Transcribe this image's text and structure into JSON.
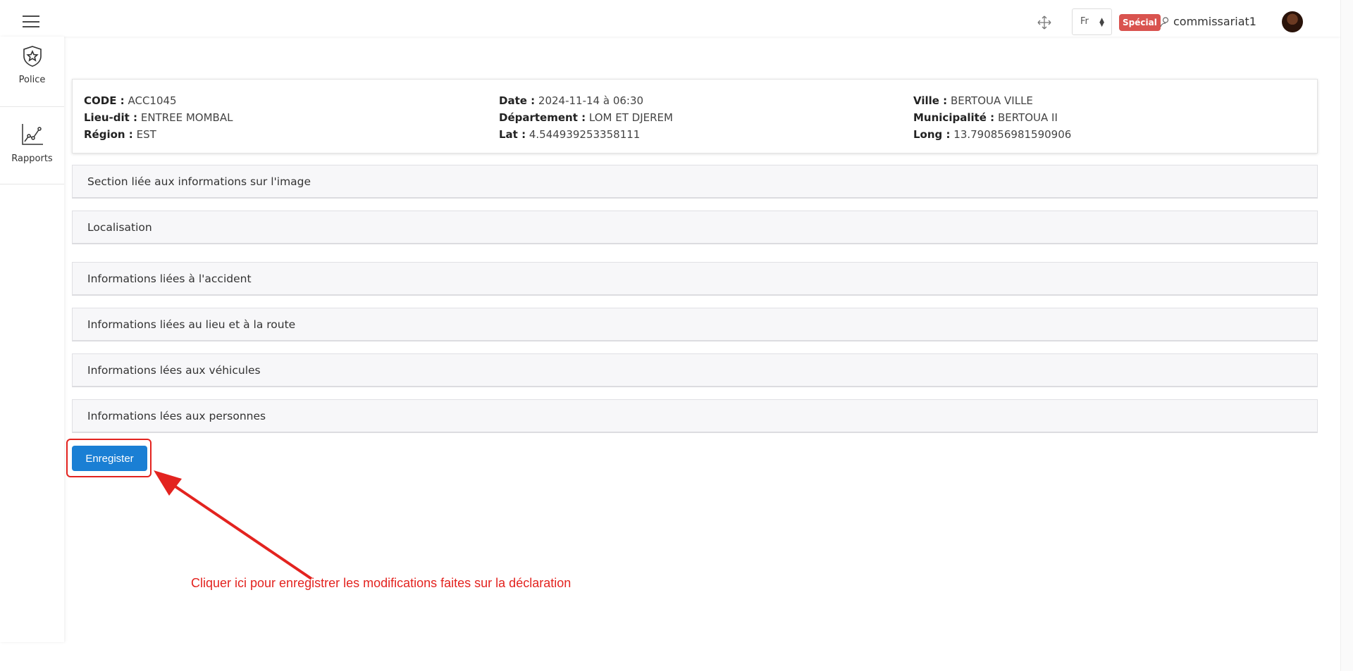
{
  "topbar": {
    "language": "Fr",
    "badge": "Spécial",
    "username": "commissariat1",
    "icons": {
      "menu": "hamburger-menu-icon",
      "move": "move-arrows-icon",
      "user": "user-icon",
      "avatar": "avatar"
    }
  },
  "sidebar": {
    "items": [
      {
        "label": "Police",
        "icon": "police-badge-icon"
      },
      {
        "label": "Rapports",
        "icon": "line-chart-icon"
      }
    ]
  },
  "info": {
    "code_label": "CODE :",
    "code": "ACC1045",
    "lieu_label": "Lieu-dit :",
    "lieu": "ENTREE MOMBAL",
    "region_label": "Région :",
    "region": "EST",
    "date_label": "Date :",
    "date": "2024-11-14 à 06:30",
    "departement_label": "Département :",
    "departement": "LOM ET DJEREM",
    "lat_label": "Lat :",
    "lat": "4.544939253358111",
    "ville_label": "Ville :",
    "ville": "BERTOUA VILLE",
    "municipalite_label": "Municipalité :",
    "municipalite": "BERTOUA II",
    "long_label": "Long :",
    "long": "13.790856981590906"
  },
  "sections": [
    "Section liée aux informations sur l'image",
    "Localisation",
    "Informations liées à l'accident",
    "Informations liées au lieu et à la route",
    "Informations lées aux véhicules",
    "Informations lées aux personnes"
  ],
  "save_button": "Enregister",
  "annotation": "Cliquer ici pour enregistrer les modifications faites sur la déclaration",
  "colors": {
    "primary": "#1a7fd4",
    "badge": "#d9534f",
    "annotation": "#e3231f"
  }
}
